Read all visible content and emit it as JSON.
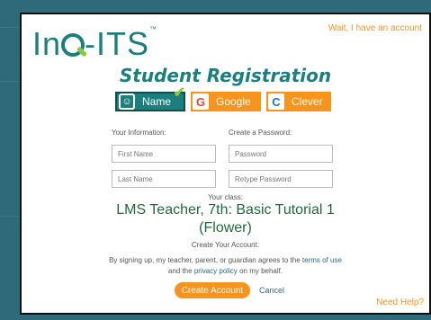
{
  "header": {
    "logo_prefix": "In",
    "logo_suffix": "-ITS",
    "logo_tm": "™",
    "wait_link": "Wait, I have an account"
  },
  "title": "Student Registration",
  "tabs": [
    {
      "label": "Name",
      "icon": "smiley-icon",
      "glyph": "☺"
    },
    {
      "label": "Google",
      "icon": "google-icon",
      "glyph": "G"
    },
    {
      "label": "Clever",
      "icon": "clever-icon",
      "glyph": "C"
    }
  ],
  "checkmark": "✔",
  "form": {
    "info_label": "Your Information:",
    "password_label": "Create a Password:",
    "first_name_placeholder": "First Name",
    "last_name_placeholder": "Last Name",
    "password_placeholder": "Password",
    "retype_placeholder": "Retype Password"
  },
  "class_info": {
    "label": "Your class:",
    "name_line1": "LMS Teacher, 7th: Basic Tutorial 1",
    "name_line2": "(Flower)"
  },
  "account": {
    "create_label": "Create Your Account:",
    "terms_part1": "By signing up, my teacher, parent, or guardian agrees to the",
    "terms_link": "terms of use",
    "terms_part2": "and the",
    "privacy_link": "privacy policy",
    "terms_part3": "on my behalf.",
    "create_button": "Create Account",
    "cancel": "Cancel"
  },
  "help": "Need Help?",
  "colors": {
    "brand_teal": "#1d7f7d",
    "accent_orange": "#f7941d",
    "class_green": "#1d6b39"
  }
}
